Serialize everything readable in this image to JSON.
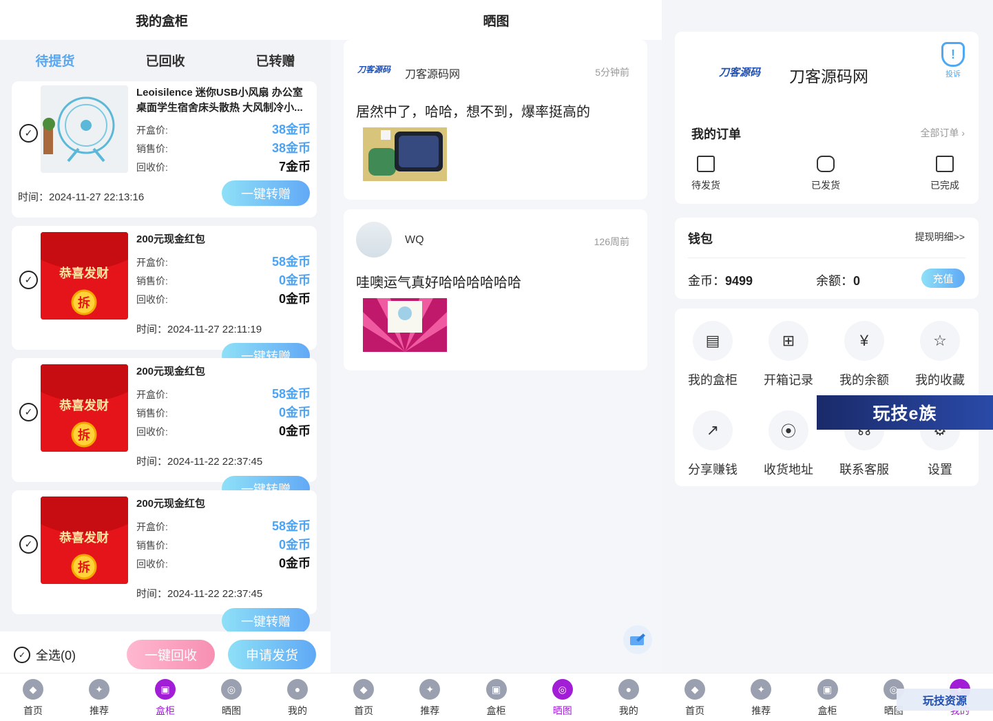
{
  "cabinet": {
    "title": "我的盒柜",
    "tabs": [
      "待提货",
      "已回收",
      "已转赠"
    ],
    "labels": {
      "open": "开盒价:",
      "sell": "销售价:",
      "recycle": "回收价:",
      "gift_button": "一键转赠"
    },
    "items": [
      {
        "name": "Leoisilence 迷你USB小风扇 办公室桌面学生宿舍床头散热 大风制冷小...",
        "open": "38金币",
        "sell": "38金币",
        "recycle": "7金币",
        "time": "时间：2024-11-27 22:13:16"
      },
      {
        "name": "200元现金红包",
        "open": "58金币",
        "sell": "0金币",
        "recycle": "0金币",
        "time": "时间：2024-11-27 22:11:19"
      },
      {
        "name": "200元现金红包",
        "open": "58金币",
        "sell": "0金币",
        "recycle": "0金币",
        "time": "时间：2024-11-22 22:37:45"
      },
      {
        "name": "200元现金红包",
        "open": "58金币",
        "sell": "0金币",
        "recycle": "0金币",
        "time": "时间：2024-11-22 22:37:45"
      }
    ],
    "redpacket": {
      "line1": "恭喜发财",
      "badge": "拆"
    },
    "select_all": "全选(0)",
    "recycle_all": "一键回收",
    "apply_ship": "申请发货"
  },
  "showcase": {
    "title": "晒图",
    "posts": [
      {
        "logo": "刀客源码",
        "user": "刀客源码网",
        "ago": "5分钟前",
        "text": "居然中了，哈哈，想不到，爆率挺高的"
      },
      {
        "user": "WQ",
        "ago": "126周前",
        "text": "哇噢运气真好哈哈哈哈哈哈"
      }
    ]
  },
  "profile": {
    "logo": "刀客源码",
    "user": "刀客源码网",
    "report": "投诉",
    "orders": {
      "title": "我的订单",
      "all": "全部订单",
      "items": [
        "待发货",
        "已发货",
        "已完成"
      ]
    },
    "wallet": {
      "title": "钱包",
      "detail": "提现明细>>",
      "coin_label": "金币：",
      "coin": "9499",
      "balance_label": "余额：",
      "balance": "0",
      "recharge": "充值"
    },
    "grid": [
      "我的盒柜",
      "开箱记录",
      "我的余额",
      "我的收藏",
      "分享赚钱",
      "收货地址",
      "联系客服",
      "设置"
    ],
    "banner": "玩技e族",
    "watermark": "玩技资源"
  },
  "tabbar": [
    "首页",
    "推荐",
    "盒柜",
    "晒图",
    "我的"
  ],
  "colors": {
    "accent_blue": "#57a6f3",
    "active_purple": "#a11ed6",
    "red_packet": "#e4141a"
  }
}
